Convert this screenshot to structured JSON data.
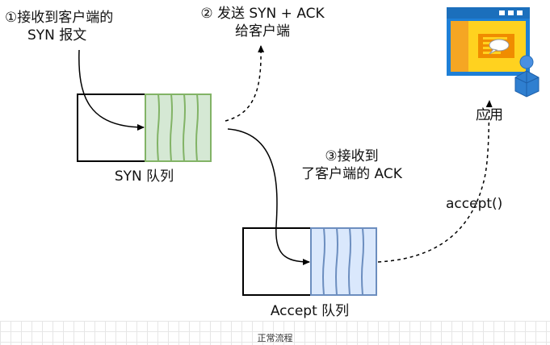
{
  "labels": {
    "step1_line1": "①接收到客户端的",
    "step1_line2": "SYN 报文",
    "step2_line1": "② 发送 SYN + ACK",
    "step2_line2": "给客户端",
    "step3_line1": "③接收到",
    "step3_line2": "了客户端的 ACK",
    "syn_queue": "SYN 队列",
    "accept_queue": "Accept 队列",
    "accept_call": "accept()",
    "app": "应用"
  },
  "caption": "正常流程",
  "colors": {
    "syn_fill": "#d5e8d4",
    "syn_stroke": "#82b366",
    "accept_fill": "#dae8fc",
    "accept_stroke": "#6c8ebf",
    "window_blue": "#1e7fd6",
    "window_yellow": "#ffd21f",
    "window_orange": "#f08c00"
  },
  "icons": {
    "app": "application-window-icon",
    "user": "user-icon"
  }
}
